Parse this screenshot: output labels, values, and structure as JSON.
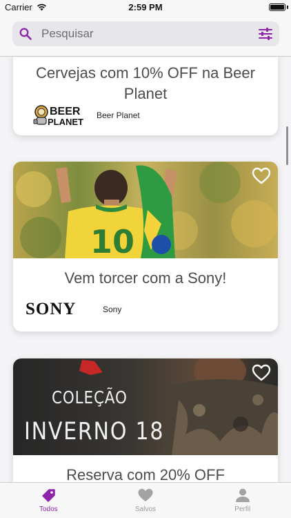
{
  "status_bar": {
    "carrier": "Carrier",
    "time": "2:59 PM"
  },
  "search": {
    "placeholder": "Pesquisar",
    "value": ""
  },
  "colors": {
    "accent": "#8e24aa",
    "tab_inactive": "#a3a3a6",
    "card_bg": "#ffffff"
  },
  "offers": [
    {
      "title": "Cervejas com 10% OFF na Beer Planet",
      "brand_name": "Beer Planet",
      "brand_logo_text": "BEER PLANET"
    },
    {
      "title": "Vem torcer com a Sony!",
      "brand_name": "Sony",
      "brand_logo_text": "SONY",
      "image_text": "10",
      "favorited": false
    },
    {
      "title": "Reserva com 20% OFF",
      "image_line1": "COLEÇÃO",
      "image_line2": "INVERNO 18",
      "favorited": false
    }
  ],
  "tabs": [
    {
      "label": "Todos",
      "icon": "tag-icon",
      "active": true
    },
    {
      "label": "Salvos",
      "icon": "heart-icon",
      "active": false
    },
    {
      "label": "Perfil",
      "icon": "person-icon",
      "active": false
    }
  ]
}
